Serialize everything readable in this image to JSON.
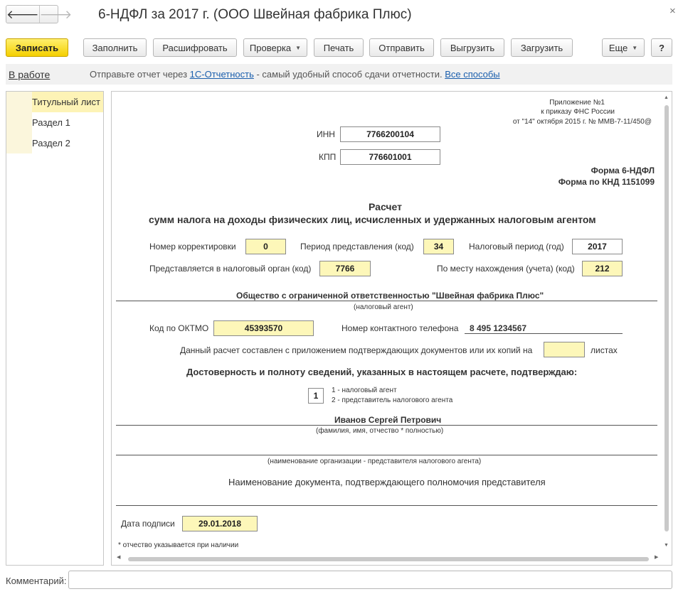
{
  "window": {
    "title": "6-НДФЛ за 2017 г. (ООО Швейная фабрика Плюс)",
    "back_icon": "arrow-left-icon",
    "forward_icon": "arrow-right-icon",
    "close_icon": "close-icon",
    "back_glyph": "🡐",
    "forward_glyph": "🡒",
    "close_glyph": "×"
  },
  "toolbar": {
    "save": "Записать",
    "fill": "Заполнить",
    "decode": "Расшифровать",
    "check": "Проверка",
    "print": "Печать",
    "send": "Отправить",
    "upload": "Выгрузить",
    "download": "Загрузить",
    "more": "Еще",
    "help": "?",
    "dropdown_glyph": "▼"
  },
  "infobar": {
    "status": "В работе",
    "text_prefix": "Отправьте отчет через ",
    "link_1c": "1С-Отчетность",
    "text_suffix": " - самый удобный способ сдачи отчетности. ",
    "link_all": "Все способы"
  },
  "sections": [
    {
      "label": "Титульный лист",
      "active": true
    },
    {
      "label": "Раздел 1",
      "active": false
    },
    {
      "label": "Раздел 2",
      "active": false
    }
  ],
  "form": {
    "appendix_1": "Приложение №1",
    "appendix_2": "к приказу ФНС России",
    "appendix_3": "от \"14\" октября 2015 г. № ММВ-7-11/450@",
    "inn_label": "ИНН",
    "inn": "7766200104",
    "kpp_label": "КПП",
    "kpp": "776601001",
    "form_name": "Форма 6-НДФЛ",
    "form_knd": "Форма по КНД 1151099",
    "heading_1": "Расчет",
    "heading_2": "сумм налога на доходы физических лиц, исчисленных и удержанных налоговым агентом",
    "correction_label": "Номер корректировки",
    "correction": "0",
    "period_label": "Период представления (код)",
    "period": "34",
    "tax_period_label": "Налоговый период (год)",
    "tax_period": "2017",
    "tax_organ_label": "Представляется в налоговый орган (код)",
    "tax_organ": "7766",
    "location_label": "По месту нахождения (учета) (код)",
    "location": "212",
    "agent_name": "Общество с ограниченной ответственностью \"Швейная фабрика Плюс\"",
    "agent_caption": "(налоговый агент)",
    "oktmo_label": "Код по ОКТМО",
    "oktmo": "45393570",
    "phone_label": "Номер контактного телефона",
    "phone": "8 495 1234567",
    "attach_label": "Данный расчет составлен с приложением подтверждающих документов или их копий на",
    "attach_value": "",
    "attach_suffix": "листах",
    "confirm_heading": "Достоверность и полноту сведений, указанных в настоящем расчете, подтверждаю:",
    "signer_code": "1",
    "signer_opt_1": "1 - налоговый агент",
    "signer_opt_2": "2 - представитель налогового агента",
    "signer_name": "Иванов Сергей Петрович",
    "signer_caption": "(фамилия, имя, отчество * полностью)",
    "rep_org_caption": "(наименование организации - представителя налогового агента)",
    "doc_label": "Наименование документа, подтверждающего полномочия представителя",
    "sign_date_label": "Дата подписи",
    "sign_date": "29.01.2018",
    "footnote": "* отчество указывается при наличии"
  },
  "comment": {
    "label": "Комментарий:",
    "value": ""
  }
}
